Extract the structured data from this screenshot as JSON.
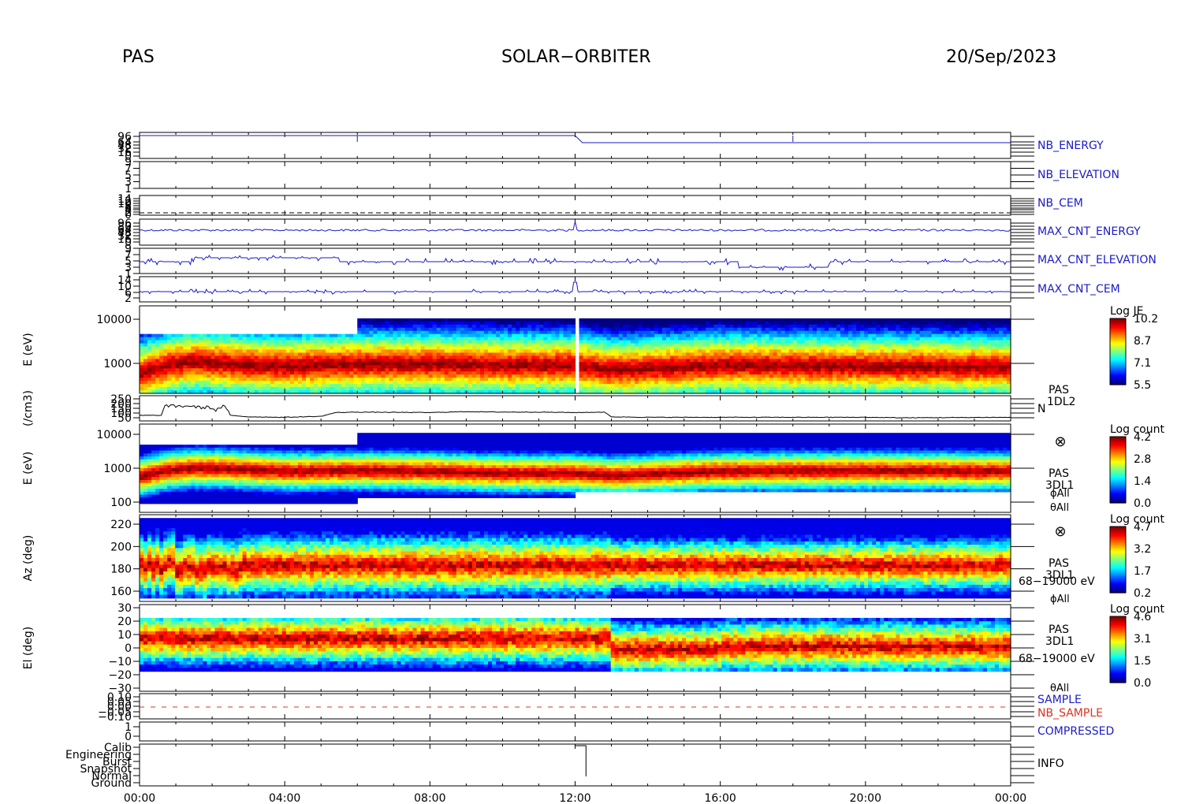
{
  "header": {
    "instrument": "PAS",
    "mission": "SOLAR−ORBITER",
    "date": "20/Sep/2023"
  },
  "chart_data": {
    "type": "stacked_time_series",
    "x": {
      "ticks": [
        "00:00",
        "04:00",
        "08:00",
        "12:00",
        "16:00",
        "20:00",
        "00:00"
      ],
      "range_hours": [
        0,
        24
      ]
    },
    "colors": {
      "line_blue": "#1a1acc",
      "line_red": "#e03020",
      "frame": "#000000"
    },
    "panels": [
      {
        "id": "nb_energy",
        "label": "NB_ENERGY",
        "label_color": "#1a1acc",
        "yticks": [
          "96",
          "64",
          "48",
          "32",
          "16",
          "0"
        ],
        "type": "line"
      },
      {
        "id": "nb_elevation",
        "label": "NB_ELEVATION",
        "label_color": "#1a1acc",
        "yticks": [
          "9",
          "7",
          "5",
          "3",
          "1"
        ],
        "type": "line"
      },
      {
        "id": "nb_cem",
        "label": "NB_CEM",
        "label_color": "#1a1acc",
        "yticks": [
          "14",
          "12",
          "10",
          "8",
          "6",
          "4",
          "2",
          "0"
        ],
        "type": "line"
      },
      {
        "id": "max_cnt_energy",
        "label": "MAX_CNT_ENERGY",
        "label_color": "#1a1acc",
        "yticks": [
          "96",
          "80",
          "64",
          "48",
          "32",
          "16",
          "0"
        ],
        "type": "line"
      },
      {
        "id": "max_cnt_elevation",
        "label": "MAX_CNT_ELEVATION",
        "label_color": "#1a1acc",
        "yticks": [
          "9",
          "7",
          "5",
          "3",
          "1"
        ],
        "type": "line"
      },
      {
        "id": "max_cnt_cem",
        "label": "MAX_CNT_CEM",
        "label_color": "#1a1acc",
        "yticks": [
          "14",
          "10",
          "6",
          "2"
        ],
        "type": "line"
      },
      {
        "id": "energy_je",
        "type": "heatmap",
        "ylabel": "E (eV)",
        "scale": "log",
        "yticks": [
          "10000",
          "1000"
        ],
        "colorbar": {
          "title": "Log JE",
          "ticks": [
            "10.2",
            "8.7",
            "7.1",
            "5.5"
          ],
          "range": [
            5.5,
            10.2
          ]
        },
        "ridge_hours": [
          0,
          0.8,
          1.5,
          2.5,
          4,
          6,
          8,
          10,
          12,
          13,
          16,
          20,
          24
        ],
        "ridge_ev": [
          560,
          900,
          1100,
          950,
          850,
          950,
          950,
          900,
          900,
          700,
          900,
          850,
          820
        ]
      },
      {
        "id": "density",
        "type": "line",
        "ylabel": "(/cm3)",
        "yticks": [
          "250",
          "200",
          "150",
          "100",
          "50"
        ],
        "annot": [
          "PAS",
          "1DL2",
          "N"
        ],
        "hours": [
          0,
          0.6,
          0.7,
          1.0,
          1.4,
          1.7,
          1.9,
          2.1,
          2.3,
          2.4,
          2.5,
          3,
          4,
          5,
          5.4,
          6,
          8,
          9,
          10,
          11,
          12,
          12.8,
          13,
          14,
          16,
          20,
          21,
          24
        ],
        "values": [
          75,
          75,
          180,
          170,
          175,
          155,
          165,
          130,
          170,
          150,
          75,
          60,
          55,
          65,
          105,
          110,
          105,
          115,
          110,
          110,
          105,
          110,
          60,
          55,
          55,
          55,
          50,
          55
        ]
      },
      {
        "id": "energy_count",
        "type": "heatmap",
        "ylabel": "E (eV)",
        "scale": "log",
        "yticks": [
          "10000",
          "1000",
          "100"
        ],
        "colorbar": {
          "title": "Log count",
          "ticks": [
            "4.2",
            "2.8",
            "1.4",
            "0.0"
          ],
          "range": [
            0,
            4.2
          ]
        },
        "annot": [
          "⊗",
          "PAS",
          "3DL1",
          "ϕAll",
          "θAll"
        ],
        "ridge_hours": [
          0,
          0.8,
          1.5,
          2.5,
          4,
          6,
          8,
          10,
          12,
          13,
          16,
          20,
          24
        ],
        "ridge_ev": [
          550,
          850,
          1000,
          950,
          800,
          850,
          800,
          700,
          700,
          600,
          800,
          850,
          800
        ]
      },
      {
        "id": "azimuth",
        "type": "heatmap",
        "ylabel": "Az (deg)",
        "yticks": [
          "220",
          "200",
          "180",
          "160"
        ],
        "colorbar": {
          "title": "Log count",
          "ticks": [
            "4.7",
            "3.2",
            "1.7",
            "0.2"
          ],
          "range": [
            0.2,
            4.7
          ]
        },
        "annot": [
          "⊗",
          "PAS",
          "3DL1",
          "68−19000 eV",
          "ϕAll"
        ]
      },
      {
        "id": "elevation",
        "type": "heatmap",
        "ylabel": "El (deg)",
        "yticks": [
          "30",
          "20",
          "10",
          "0",
          "−10",
          "−20",
          "−30"
        ],
        "colorbar": {
          "title": "Log count",
          "ticks": [
            "4.6",
            "3.1",
            "1.5",
            "0.0"
          ],
          "range": [
            0,
            4.6
          ]
        },
        "annot": [
          "PAS",
          "3DL1",
          "68−19000 eV",
          "θAll"
        ]
      },
      {
        "id": "sample",
        "labels": [
          "SAMPLE",
          "NB_SAMPLE"
        ],
        "label_colors": [
          "#1a1acc",
          "#e03020"
        ],
        "yticks": [
          "0.10",
          "0.05",
          "0.00",
          "−0.05",
          "−0.10"
        ],
        "type": "line"
      },
      {
        "id": "compressed",
        "label": "COMPRESSED",
        "label_color": "#1a1acc",
        "yticks": [
          "1",
          "0"
        ],
        "type": "line"
      },
      {
        "id": "info",
        "label": "INFO",
        "label_color": "#000000",
        "yticks": [
          "Calib",
          "Engineering",
          "Burst",
          "Snapshot",
          "Normal",
          "Ground"
        ],
        "type": "line"
      }
    ]
  }
}
